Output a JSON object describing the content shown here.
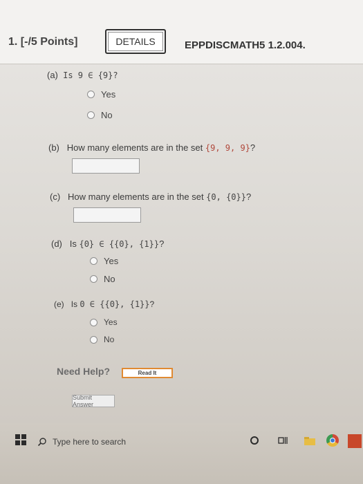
{
  "header": {
    "question_number": "1. [-/5 Points]",
    "details_label": "DETAILS",
    "problem_code": "EPPDISCMATH5 1.2.004."
  },
  "parts": {
    "a": {
      "label": "(a)",
      "text": "Is 9 ∈ ",
      "set": "{9}",
      "suffix": "?",
      "options": [
        "Yes",
        "No"
      ]
    },
    "b": {
      "label": "(b)",
      "text": "How many elements are in the set ",
      "set": "{9, 9, 9}",
      "suffix": "?"
    },
    "c": {
      "label": "(c)",
      "text": "How many elements are in the set ",
      "set": "{0, {0}}",
      "suffix": "?"
    },
    "d": {
      "label": "(d)",
      "text": "Is ",
      "expr": "{0} ∈ {{0}, {1}}",
      "suffix": "?",
      "options": [
        "Yes",
        "No"
      ]
    },
    "e": {
      "label": "(e)",
      "text": "Is ",
      "expr": "0 ∈ {{0}, {1}}",
      "suffix": "?",
      "options": [
        "Yes",
        "No"
      ]
    }
  },
  "help": {
    "need_help": "Need Help?",
    "read_it": "Read It"
  },
  "submit_label": "Submit Answer",
  "taskbar": {
    "search_placeholder": "Type here to search"
  },
  "colors": {
    "set_highlight": "#b0473a",
    "read_it_border": "#e08a32"
  }
}
